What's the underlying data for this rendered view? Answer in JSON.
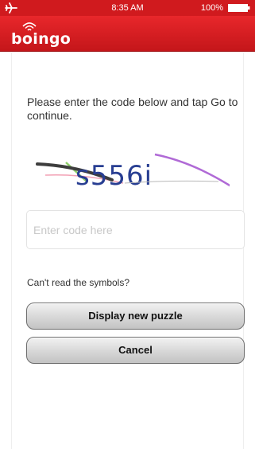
{
  "status_bar": {
    "time": "8:35 AM",
    "battery": "100%",
    "icons": [
      "airplane-icon",
      "battery-icon"
    ]
  },
  "nav": {
    "brand": "boingo",
    "brand_icon": "wifi-signal-icon",
    "color": "#d01a1e"
  },
  "form": {
    "instructions": "Please enter the code below and tap Go to continue.",
    "captcha_text": "s556i",
    "code_placeholder": "Enter code here",
    "code_value": "",
    "cant_read": "Can't read the symbols?",
    "new_puzzle_label": "Display new puzzle",
    "cancel_label": "Cancel"
  }
}
